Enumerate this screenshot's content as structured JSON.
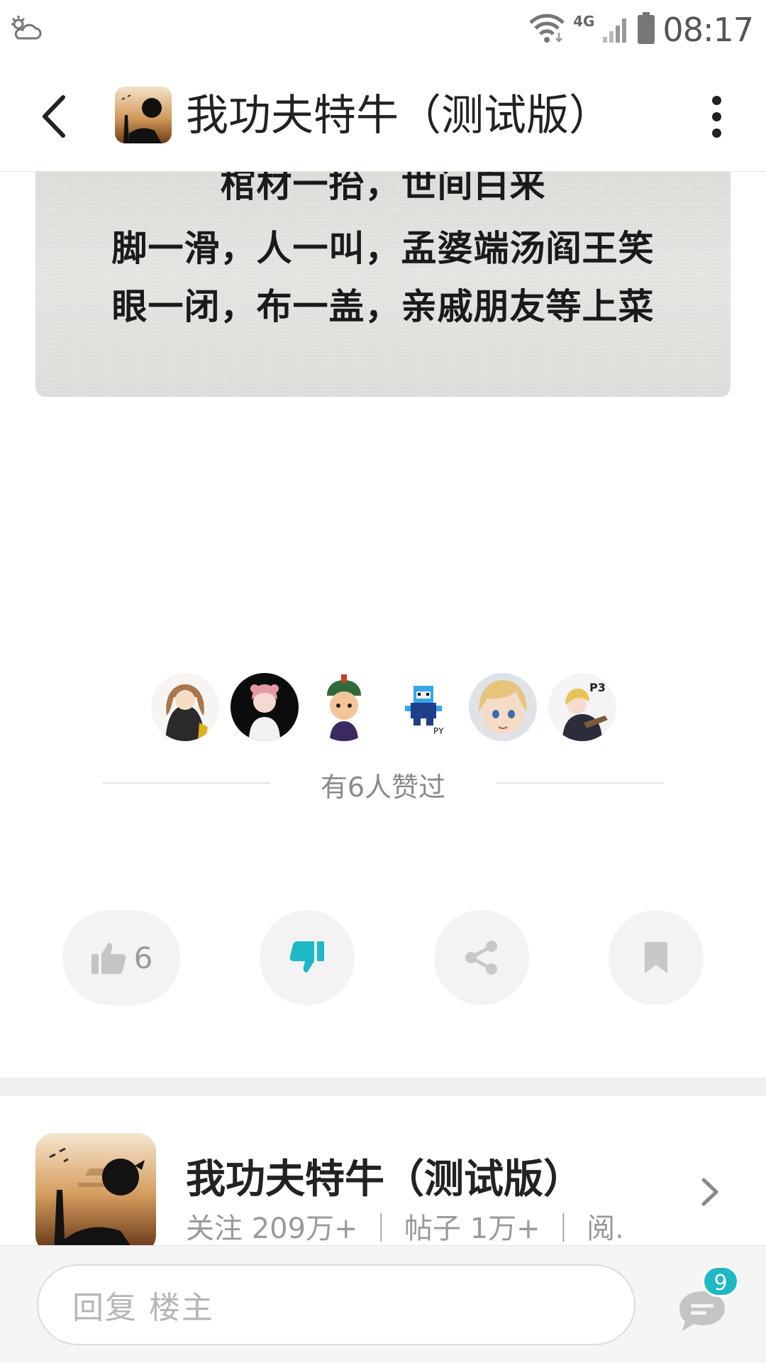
{
  "status_bar": {
    "time": "08:17",
    "network": "4G",
    "icons": [
      "weather-icon",
      "wifi-icon",
      "signal-icon",
      "battery-icon"
    ]
  },
  "header": {
    "title": "我功夫特牛（测试版）",
    "back_icon": "chevron-left-icon",
    "more_icon": "more-vertical-icon"
  },
  "post": {
    "image_text_lines": [
      "棺材一抬，世间白来",
      "脚一滑，人一叫，孟婆端汤阎王笑",
      "眼一闭，布一盖，亲戚朋友等上菜"
    ]
  },
  "likes": {
    "summary": "有6人赞过",
    "avatar_count": 6
  },
  "actions": {
    "like_count": "6",
    "like_icon": "thumbs-up-icon",
    "dislike_icon": "thumbs-down-icon",
    "share_icon": "share-icon",
    "bookmark_icon": "bookmark-icon",
    "dislike_active_color": "#1fb8c6",
    "inactive_color": "#c4c4c4"
  },
  "forum": {
    "name": "我功夫特牛（测试版）",
    "stats": "关注 209万+ ｜ 帖子 1万+ ｜ 阅..."
  },
  "reply_bar": {
    "placeholder": "回复  楼主",
    "comment_count": "9",
    "comment_icon": "comment-icon"
  },
  "colors": {
    "accent": "#1fb8c6",
    "separator": "#efefef"
  }
}
